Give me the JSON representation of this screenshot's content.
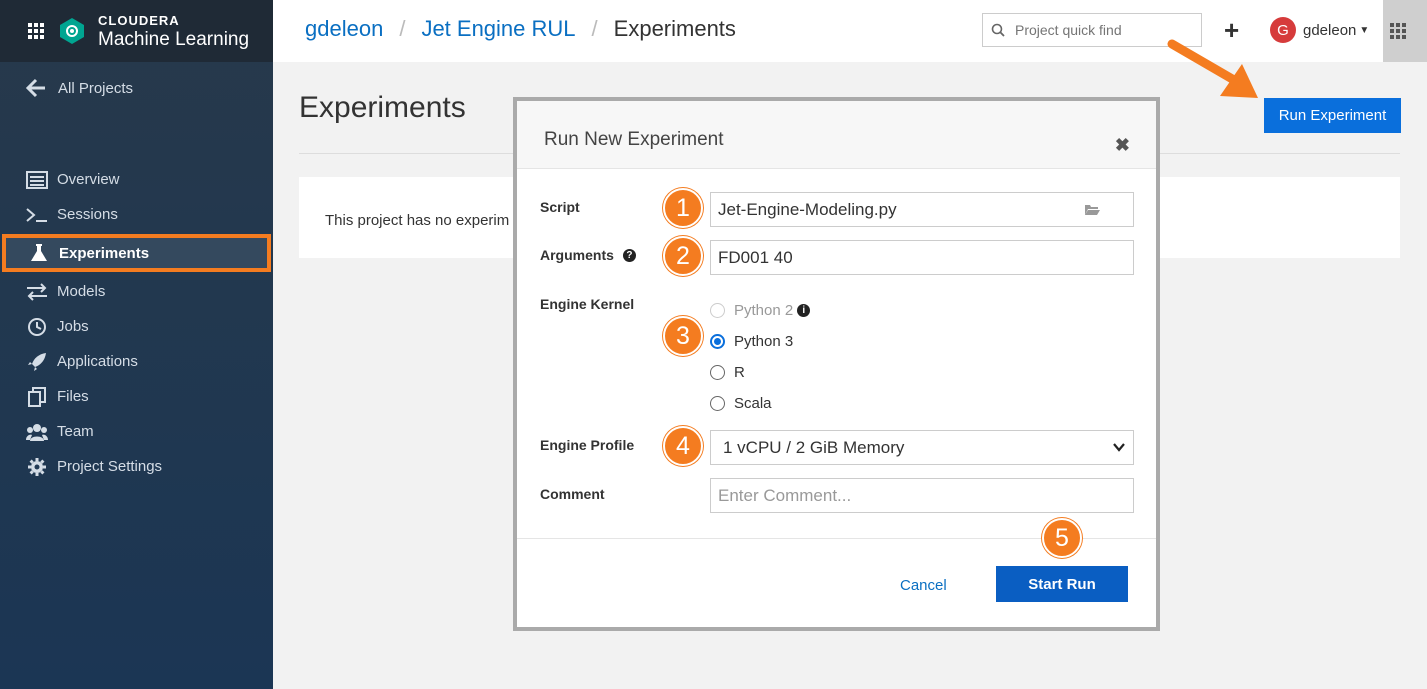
{
  "brand": {
    "company": "CLOUDERA",
    "product": "Machine Learning"
  },
  "sidebar": {
    "all_projects": "All Projects",
    "items": [
      {
        "label": "Overview",
        "icon": "overview-icon"
      },
      {
        "label": "Sessions",
        "icon": "terminal-icon"
      },
      {
        "label": "Experiments",
        "icon": "flask-icon",
        "active": true
      },
      {
        "label": "Models",
        "icon": "arrows-icon"
      },
      {
        "label": "Jobs",
        "icon": "clock-icon"
      },
      {
        "label": "Applications",
        "icon": "rocket-icon"
      },
      {
        "label": "Files",
        "icon": "files-icon"
      },
      {
        "label": "Team",
        "icon": "team-icon"
      },
      {
        "label": "Project Settings",
        "icon": "gear-icon"
      }
    ]
  },
  "header": {
    "breadcrumb": {
      "user": "gdeleon",
      "project": "Jet Engine RUL",
      "current": "Experiments"
    },
    "search_placeholder": "Project quick find",
    "plus_label": "+",
    "username": "gdeleon",
    "avatar_initial": "G"
  },
  "main": {
    "title": "Experiments",
    "run_button": "Run Experiment",
    "empty_message": "This project has no experim"
  },
  "modal": {
    "title": "Run New Experiment",
    "close": "✖",
    "script_label": "Script",
    "script_value": "Jet-Engine-Modeling.py",
    "arguments_label": "Arguments",
    "arguments_value": "FD001 40",
    "kernel_label": "Engine Kernel",
    "kernels": [
      "Python 2",
      "Python 3",
      "R",
      "Scala"
    ],
    "selected_kernel": "Python 3",
    "profile_label": "Engine Profile",
    "profile_value": "1 vCPU / 2 GiB Memory",
    "comment_label": "Comment",
    "comment_placeholder": "Enter Comment...",
    "cancel": "Cancel",
    "start": "Start Run",
    "steps": [
      "1",
      "2",
      "3",
      "4",
      "5"
    ]
  },
  "colors": {
    "accent": "#0a6fdc",
    "highlight": "#f47c20",
    "sidebar": "#1f3550"
  }
}
